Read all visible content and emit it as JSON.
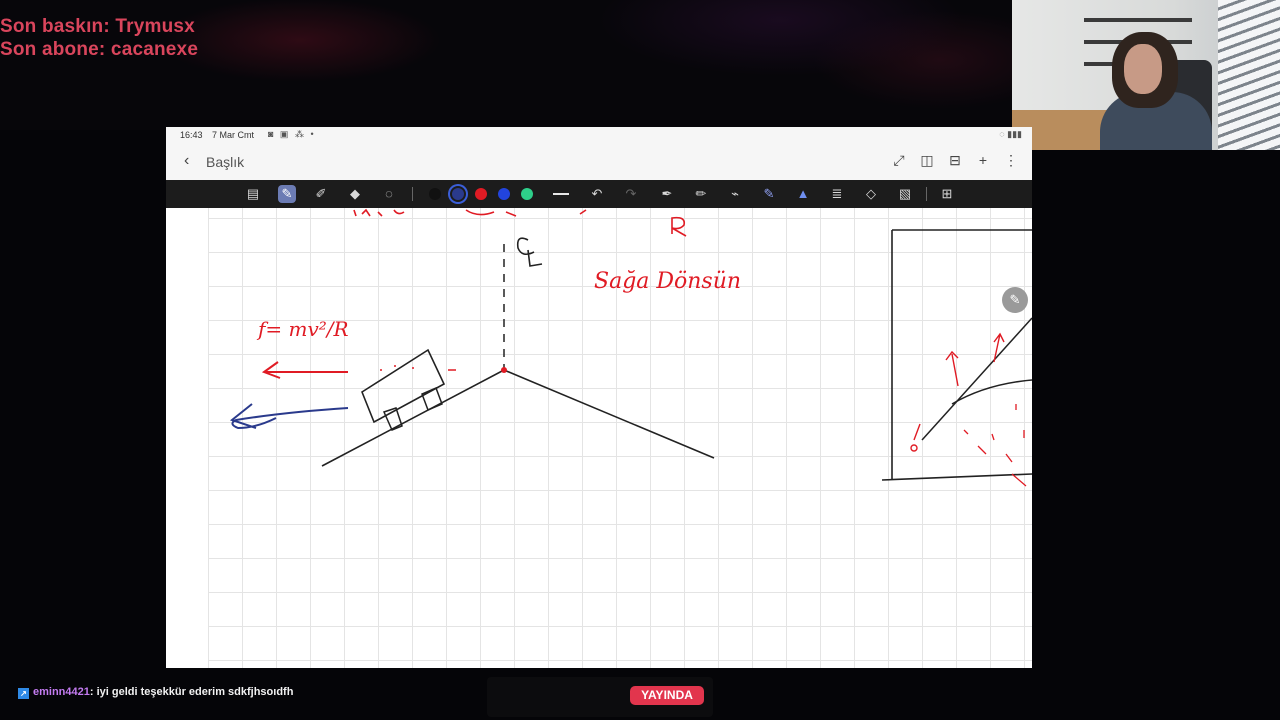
{
  "stream_overlay": {
    "last_raid": "Son baskın: Trymusx",
    "last_sub": "Son abone: cacanexe"
  },
  "statusbar": {
    "time": "16:43",
    "date": "7 Mar Cmt"
  },
  "header": {
    "title": "Başlık"
  },
  "toolbar": {
    "pen_colors": [
      "#111111",
      "#2a3a8c",
      "#e01b24",
      "#2244dd",
      "#2ecf8a"
    ]
  },
  "canvas": {
    "handwriting": {
      "force_formula": "f= mv²/R",
      "word_right": "Sağa Dönsün"
    }
  },
  "chat": {
    "user": "eminn4421",
    "message": ": iyi geldi teşekkür ederim sdkfjhsoıdfh"
  },
  "live_badge": "YAYINDA",
  "colors": {
    "overlay_text": "#d9455c",
    "live_bg": "#e2354d",
    "toolbar_bg": "#1c1c1c",
    "ink_red": "#e01b24",
    "ink_blue": "#2a3a8c"
  }
}
